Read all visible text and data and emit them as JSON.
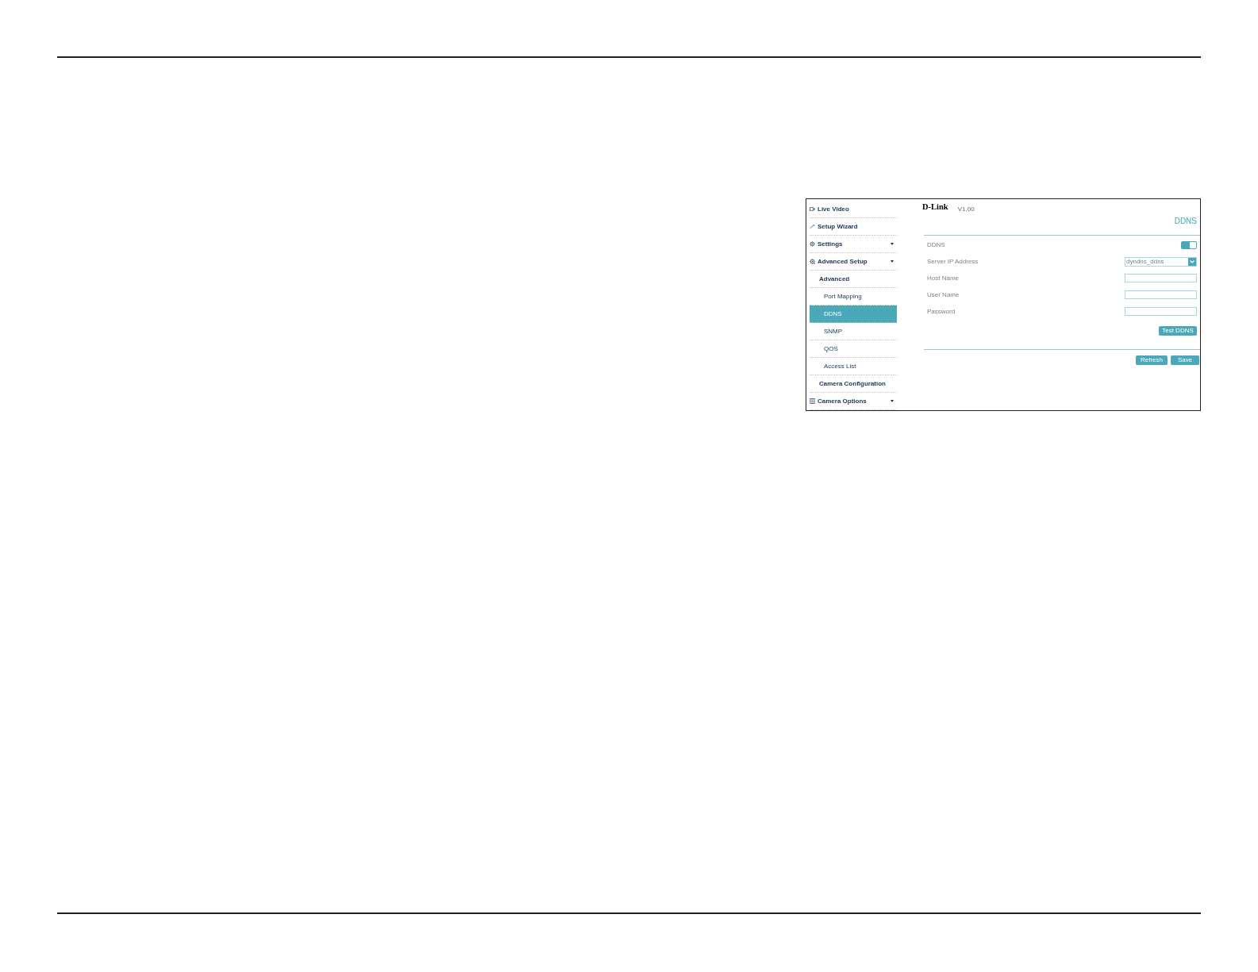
{
  "sidebar": {
    "items": [
      {
        "label": "Live Video",
        "kind": "link",
        "selected": false
      },
      {
        "label": "Setup Wizard",
        "kind": "link",
        "selected": false
      },
      {
        "label": "Settings",
        "kind": "menu",
        "selected": false
      },
      {
        "label": "Advanced Setup",
        "kind": "menu",
        "selected": false,
        "children": [
          {
            "label": "Advanced",
            "kind": "link",
            "selected": false,
            "children": [
              {
                "label": "Port Mapping",
                "kind": "link",
                "selected": false
              },
              {
                "label": "DDNS",
                "kind": "link",
                "selected": true
              },
              {
                "label": "SNMP",
                "kind": "link",
                "selected": false
              },
              {
                "label": "QOS",
                "kind": "link",
                "selected": false
              },
              {
                "label": "Access List",
                "kind": "link",
                "selected": false
              }
            ]
          },
          {
            "label": "Camera Configuration",
            "kind": "link",
            "selected": false
          }
        ]
      },
      {
        "label": "Camera Options",
        "kind": "menu",
        "selected": false
      }
    ]
  },
  "header": {
    "logo": "D-Link",
    "version": "V1.00"
  },
  "page_title": "DDNS",
  "form": {
    "fields": [
      {
        "label": "DDNS",
        "kind": "toggle",
        "on": true
      },
      {
        "label": "Server IP Address",
        "kind": "select",
        "value": "dyndns_ddns"
      },
      {
        "label": "Host Name",
        "kind": "text"
      },
      {
        "label": "User Name",
        "kind": "text"
      },
      {
        "label": "Password",
        "kind": "text"
      }
    ]
  },
  "test_button": "Test DDNS",
  "buttons": [
    "Refresh",
    "Save"
  ]
}
